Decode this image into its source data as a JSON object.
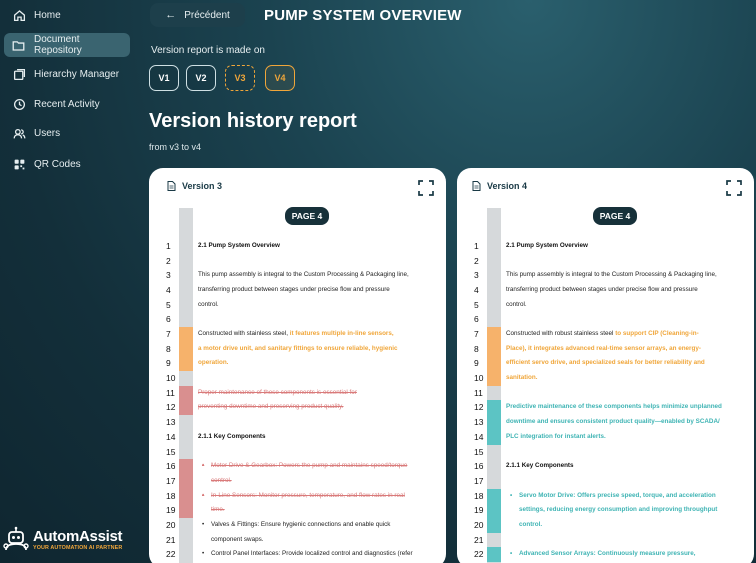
{
  "sidebar": {
    "items": [
      {
        "label": "Home",
        "icon": "home-icon"
      },
      {
        "label": "Document Repository",
        "icon": "folder-icon",
        "active": true
      },
      {
        "label": "Hierarchy Manager",
        "icon": "layers-icon"
      },
      {
        "label": "Recent Activity",
        "icon": "clock-icon"
      },
      {
        "label": "Users",
        "icon": "users-icon"
      },
      {
        "label": "QR Codes",
        "icon": "qr-icon"
      }
    ],
    "logo_title": "AutomAssist",
    "logo_sub": "YOUR AUTOMATION AI PARTNER"
  },
  "header": {
    "back_label": "Précédent",
    "title": "PUMP SYSTEM OVERVIEW"
  },
  "versions": {
    "label": "Version report is made on",
    "buttons": [
      {
        "label": "V1",
        "state": "normal"
      },
      {
        "label": "V2",
        "state": "normal"
      },
      {
        "label": "V3",
        "state": "compare"
      },
      {
        "label": "V4",
        "state": "selected"
      }
    ]
  },
  "report": {
    "title": "Version history report",
    "subtitle": "from v3 to v4"
  },
  "colors": {
    "accent": "#f0a63a",
    "added": "#5cc4c4",
    "removed": "#d98f8f",
    "changed": "#f6b26b"
  },
  "panels": [
    {
      "title": "Version 3",
      "page": "PAGE 4",
      "lines": [
        {
          "n": "1",
          "segs": [
            {
              "t": "2.1 Pump System Overview",
              "s": "bold"
            }
          ]
        },
        {
          "n": "2",
          "segs": []
        },
        {
          "n": "3",
          "segs": [
            {
              "t": "This pump assembly is integral to the Custom Processing & Packaging line,",
              "s": ""
            }
          ]
        },
        {
          "n": "4",
          "segs": [
            {
              "t": "transferring product between stages under precise flow and pressure",
              "s": ""
            }
          ]
        },
        {
          "n": "5",
          "segs": [
            {
              "t": "control.",
              "s": ""
            }
          ]
        },
        {
          "n": "6",
          "segs": []
        },
        {
          "n": "7",
          "mark": "orange",
          "segs": [
            {
              "t": "Constructed with stainless steel, ",
              "s": ""
            },
            {
              "t": "it features multiple in-line sensors,",
              "s": "orange"
            }
          ]
        },
        {
          "n": "8",
          "mark": "orange",
          "segs": [
            {
              "t": "a motor drive unit, and sanitary fittings to ensure reliable, hygienic",
              "s": "orange"
            }
          ]
        },
        {
          "n": "9",
          "mark": "orange",
          "segs": [
            {
              "t": "operation.",
              "s": "orange"
            }
          ]
        },
        {
          "n": "10",
          "segs": []
        },
        {
          "n": "11",
          "mark": "red",
          "segs": [
            {
              "t": "Proper maintenance of these components is essential for",
              "s": "red"
            }
          ]
        },
        {
          "n": "12",
          "mark": "red",
          "segs": [
            {
              "t": "preventing downtime and preserving product quality.",
              "s": "red"
            }
          ]
        },
        {
          "n": "13",
          "segs": []
        },
        {
          "n": "14",
          "segs": [
            {
              "t": "2.1.1 Key Components",
              "s": "bold"
            }
          ]
        },
        {
          "n": "15",
          "segs": []
        },
        {
          "n": "16",
          "mark": "red",
          "segs": [
            {
              "t": "•",
              "s": "red bullet"
            },
            {
              "t": "Motor Drive & Gearbox: Powers the pump and maintains speed/torque",
              "s": "red"
            }
          ]
        },
        {
          "n": "17",
          "mark": "red",
          "segs": [
            {
              "t": "",
              "s": "bullet"
            },
            {
              "t": "control.",
              "s": "red"
            }
          ]
        },
        {
          "n": "18",
          "mark": "red",
          "segs": [
            {
              "t": "•",
              "s": "red bullet"
            },
            {
              "t": "In-Line Sensors: Monitor pressure, temperature, and flow rates in real",
              "s": "red"
            }
          ]
        },
        {
          "n": "19",
          "mark": "red",
          "segs": [
            {
              "t": "",
              "s": "bullet"
            },
            {
              "t": "time.",
              "s": "red"
            }
          ]
        },
        {
          "n": "20",
          "segs": [
            {
              "t": "•",
              "s": "bullet"
            },
            {
              "t": "Valves & Fittings: Ensure hygienic connections and enable quick",
              "s": ""
            }
          ]
        },
        {
          "n": "21",
          "segs": [
            {
              "t": "",
              "s": "bullet"
            },
            {
              "t": "component swaps.",
              "s": ""
            }
          ]
        },
        {
          "n": "22",
          "segs": [
            {
              "t": "•",
              "s": "bullet"
            },
            {
              "t": "Control Panel Interfaces: Provide localized control and diagnostics (refer",
              "s": ""
            }
          ]
        }
      ]
    },
    {
      "title": "Version 4",
      "page": "PAGE 4",
      "lines": [
        {
          "n": "1",
          "segs": [
            {
              "t": "2.1 Pump System Overview",
              "s": "bold"
            }
          ]
        },
        {
          "n": "2",
          "segs": []
        },
        {
          "n": "3",
          "segs": [
            {
              "t": "This pump assembly is integral to the Custom Processing & Packaging line,",
              "s": ""
            }
          ]
        },
        {
          "n": "4",
          "segs": [
            {
              "t": "transferring product between stages under precise flow and pressure",
              "s": ""
            }
          ]
        },
        {
          "n": "5",
          "segs": [
            {
              "t": "control.",
              "s": ""
            }
          ]
        },
        {
          "n": "6",
          "segs": []
        },
        {
          "n": "7",
          "mark": "orange",
          "segs": [
            {
              "t": "Constructed with robust stainless steel ",
              "s": ""
            },
            {
              "t": "to support CIP (Cleaning-in-",
              "s": "orange"
            }
          ]
        },
        {
          "n": "8",
          "mark": "orange",
          "segs": [
            {
              "t": "Place), it integrates advanced real-time sensor arrays, an energy-",
              "s": "orange"
            }
          ]
        },
        {
          "n": "9",
          "mark": "orange",
          "segs": [
            {
              "t": "efficient servo drive, and specialized seals for better reliability and",
              "s": "orange"
            }
          ]
        },
        {
          "n": "10",
          "mark": "orange",
          "segs": [
            {
              "t": "sanitation.",
              "s": "orange"
            }
          ]
        },
        {
          "n": "11",
          "segs": []
        },
        {
          "n": "12",
          "mark": "teal",
          "segs": [
            {
              "t": "Predictive maintenance of these components helps minimize unplanned",
              "s": "teal"
            }
          ]
        },
        {
          "n": "13",
          "mark": "teal",
          "segs": [
            {
              "t": "downtime and ensures consistent product quality—enabled by SCADA/",
              "s": "teal"
            }
          ]
        },
        {
          "n": "14",
          "mark": "teal",
          "segs": [
            {
              "t": "PLC integration for instant alerts.",
              "s": "teal"
            }
          ]
        },
        {
          "n": "15",
          "segs": []
        },
        {
          "n": "16",
          "segs": [
            {
              "t": "2.1.1 Key Components",
              "s": "bold"
            }
          ]
        },
        {
          "n": "17",
          "segs": []
        },
        {
          "n": "18",
          "mark": "teal",
          "segs": [
            {
              "t": "•",
              "s": "teal bullet"
            },
            {
              "t": "Servo Motor Drive: Offers precise speed, torque, and acceleration",
              "s": "teal"
            }
          ]
        },
        {
          "n": "19",
          "mark": "teal",
          "segs": [
            {
              "t": "",
              "s": "bullet"
            },
            {
              "t": "settings, reducing energy consumption and improving throughput",
              "s": "teal"
            }
          ]
        },
        {
          "n": "20",
          "mark": "teal",
          "segs": [
            {
              "t": "",
              "s": "bullet"
            },
            {
              "t": "control.",
              "s": "teal"
            }
          ]
        },
        {
          "n": "21",
          "segs": []
        },
        {
          "n": "22",
          "mark": "teal",
          "segs": [
            {
              "t": "•",
              "s": "teal bullet"
            },
            {
              "t": "Advanced Sensor Arrays: Continuously measure pressure,",
              "s": "teal"
            }
          ]
        }
      ]
    }
  ]
}
